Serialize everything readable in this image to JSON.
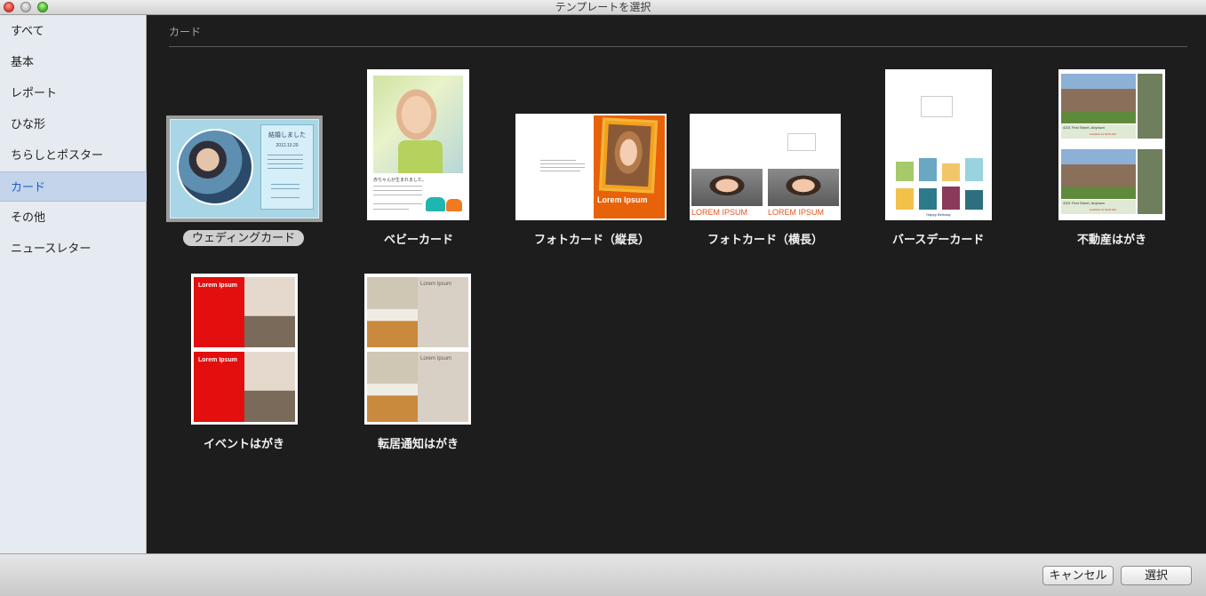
{
  "window": {
    "title": "テンプレートを選択"
  },
  "sidebar": {
    "items": [
      {
        "label": "すべて"
      },
      {
        "label": "基本"
      },
      {
        "label": "レポート"
      },
      {
        "label": "ひな形"
      },
      {
        "label": "ちらしとポスター"
      },
      {
        "label": "カード"
      },
      {
        "label": "その他"
      },
      {
        "label": "ニュースレター"
      }
    ],
    "selected": "カード"
  },
  "section": {
    "title": "カード"
  },
  "templates": [
    {
      "caption": "ウェディングカード",
      "selected": true,
      "thumb_text": {
        "heading": "結婚しました",
        "date": "2012.10.20"
      }
    },
    {
      "caption": "ベビーカード",
      "thumb_text": {
        "line": "赤ちゃんが生まれました。"
      }
    },
    {
      "caption": "フォトカード（縦長）",
      "thumb_text": {
        "title": "Lorem Ipsum"
      }
    },
    {
      "caption": "フォトカード（横長）",
      "thumb_text": {
        "title1": "LOREM IPSUM",
        "title2": "LOREM IPSUM"
      }
    },
    {
      "caption": "バースデーカード",
      "thumb_text": {
        "footer": "Happy Birthday"
      }
    },
    {
      "caption": "不動産はがき",
      "thumb_text": {
        "address": "4321 First Street, Anytown",
        "price": "Available for $125,000"
      }
    },
    {
      "caption": "イベントはがき",
      "thumb_text": {
        "title": "Lorem Ipsum"
      }
    },
    {
      "caption": "転居通知はがき",
      "thumb_text": {
        "title": "Lorem Ipsum"
      }
    }
  ],
  "footer": {
    "cancel_label": "キャンセル",
    "select_label": "選択"
  },
  "colors": {
    "selection": "#c4d4eb",
    "accent_orange": "#e8620a",
    "accent_red": "#e30f0f",
    "content_bg": "#1d1d1d"
  }
}
